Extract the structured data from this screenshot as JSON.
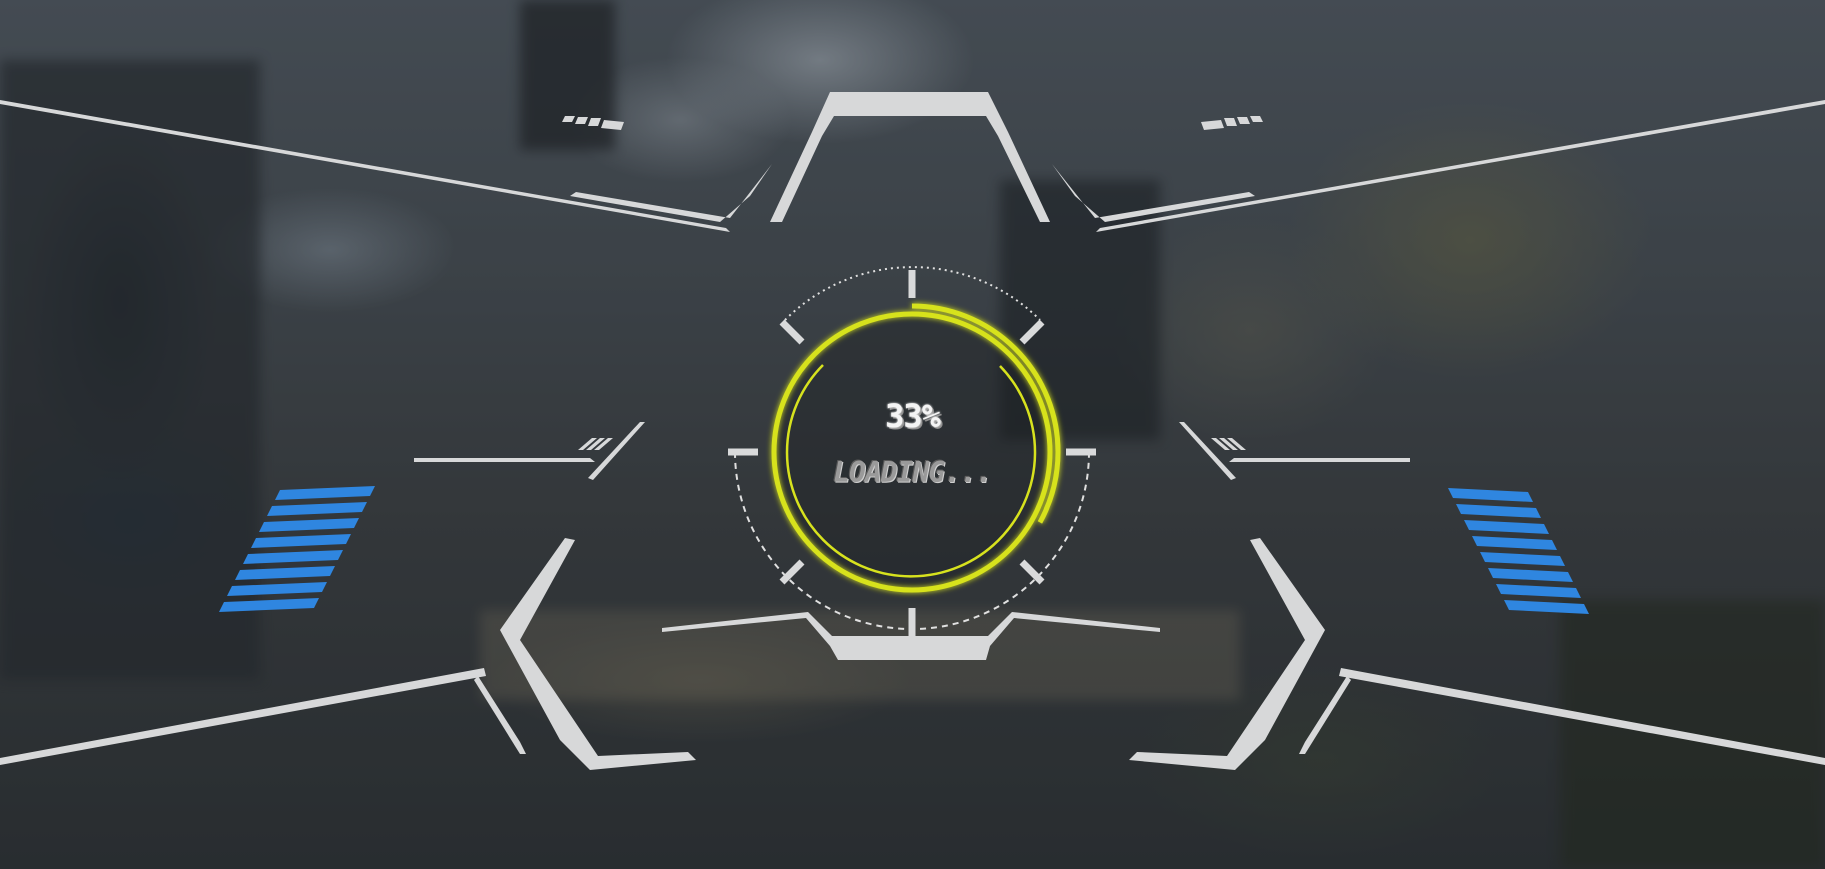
{
  "loading": {
    "percent_text": "33%",
    "status_text": "LOADING...",
    "progress": 0.33
  },
  "colors": {
    "accent": "#d7e21e",
    "frame": "#d9dadb",
    "stripes": "#2f86e0"
  },
  "icons": {
    "progress_ring": "progress-ring-icon",
    "stripes": "stripe-icon",
    "chevrons": "chevron-icon"
  }
}
